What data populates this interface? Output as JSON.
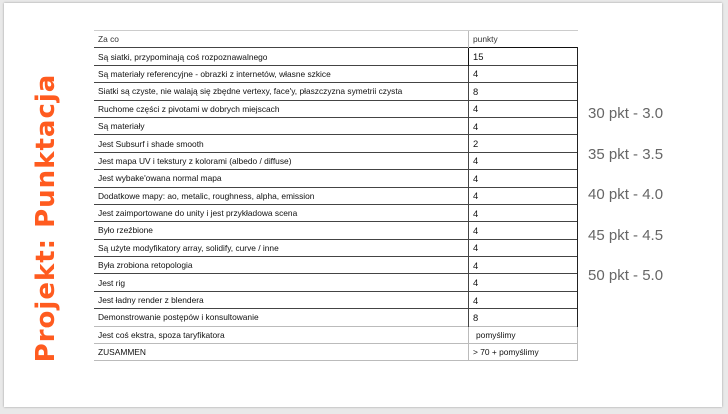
{
  "title": "Projekt: Punktacja",
  "table": {
    "header": {
      "label": "Za co",
      "points": "punkty"
    },
    "rows": [
      {
        "label": "Są siatki, przypominają coś rozpoznawalnego",
        "points": "15"
      },
      {
        "label": "Są materiały referencyjne - obrazki z internetów, własne szkice",
        "points": "4"
      },
      {
        "label": "Siatki są czyste, nie walają się zbędne vertexy, face'y, płaszczyzna symetrii czysta",
        "points": "8"
      },
      {
        "label": "Ruchome części z pivotami w dobrych miejscach",
        "points": "4"
      },
      {
        "label": "Są materiały",
        "points": "4"
      },
      {
        "label": "Jest Subsurf i shade smooth",
        "points": "2"
      },
      {
        "label": "Jest mapa UV i tekstury z kolorami (albedo / diffuse)",
        "points": "4"
      },
      {
        "label": "Jest wybake'owana normal mapa",
        "points": "4"
      },
      {
        "label": "Dodatkowe mapy: ao, metalic, roughness, alpha, emission",
        "points": "4"
      },
      {
        "label": "Jest zaimportowane do unity i jest przykładowa scena",
        "points": "4"
      },
      {
        "label": "Było rzeźbione",
        "points": "4"
      },
      {
        "label": "Są użyte modyfikatory array, solidify, curve / inne",
        "points": "4"
      },
      {
        "label": "Była zrobiona retopologia",
        "points": "4"
      },
      {
        "label": "Jest rig",
        "points": "4"
      },
      {
        "label": "Jest ładny render z blendera",
        "points": "4"
      },
      {
        "label": "Demonstrowanie postępów i konsultowanie",
        "points": "8"
      },
      {
        "label": "Jest coś ekstra, spoza taryfikatora",
        "points": "pomyślimy"
      }
    ],
    "total": {
      "label": "ZUSAMMEN",
      "points": "> 70 + pomyślimy"
    }
  },
  "grades": [
    "30 pkt - 3.0",
    "35 pkt - 3.5",
    "40 pkt - 4.0",
    "45 pkt - 4.5",
    "50 pkt - 5.0"
  ],
  "colors": {
    "title": "#ff5b1f",
    "grades": "#666666",
    "slide_bg": "#ffffff",
    "canvas_bg": "#e9e9e9"
  }
}
